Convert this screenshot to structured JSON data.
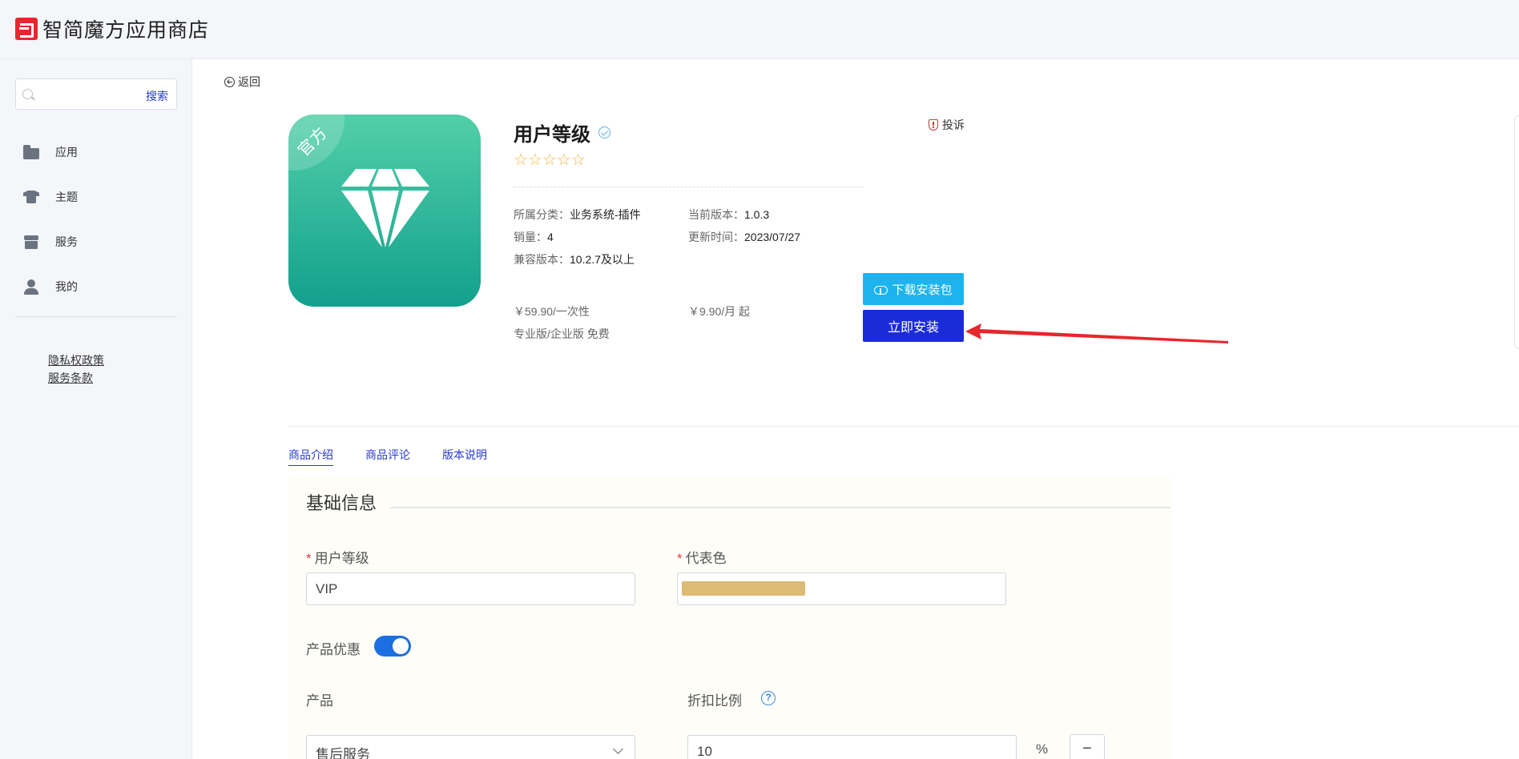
{
  "header": {
    "title": "智简魔方应用商店"
  },
  "sidebar": {
    "search": {
      "placeholder": "",
      "button": "搜索"
    },
    "items": [
      {
        "label": "应用",
        "icon": "folder-icon"
      },
      {
        "label": "主题",
        "icon": "shirt-icon"
      },
      {
        "label": "服务",
        "icon": "store-icon"
      },
      {
        "label": "我的",
        "icon": "user-icon"
      }
    ],
    "footer_links": [
      "隐私权政策",
      "服务条款"
    ]
  },
  "main": {
    "back": "返回",
    "app": {
      "badge": "官方",
      "title": "用户等级",
      "rating": 0,
      "stars": "☆☆☆☆☆",
      "category_key": "所属分类：",
      "category_value": "业务系统-插件",
      "sales_key": "销量：",
      "sales_value": "4",
      "compat_key": "兼容版本：",
      "compat_value": "10.2.7及以上",
      "version_key": "当前版本：",
      "version_value": "1.0.3",
      "updated_key": "更新时间：",
      "updated_value": "2023/07/27",
      "price_once": "￥59.90/一次性",
      "price_monthly": "￥9.90/月 起",
      "edition_note": "专业版/企业版 免费",
      "report": "投诉",
      "download_button": "下载安装包",
      "install_button": "立即安装"
    },
    "tabs": [
      {
        "label": "商品介绍",
        "active": true
      },
      {
        "label": "商品评论",
        "active": false
      },
      {
        "label": "版本说明",
        "active": false
      }
    ],
    "preview": {
      "heading": "基础信息",
      "required_mark": "*",
      "level_label": "用户等级",
      "level_value": "VIP",
      "color_label": "代表色",
      "color_value": "#ddbb74",
      "discount_label": "产品优惠",
      "discount_enabled": true,
      "product_label": "产品",
      "product_value": "售后服务",
      "ratio_label": "折扣比例",
      "ratio_value": "10",
      "percent": "%",
      "minus": "−"
    }
  },
  "colors": {
    "accent": "#2838d6",
    "install": "#1c2bd8",
    "download": "#1cb3ee",
    "app_icon_top": "#52cfa8",
    "app_icon_bottom": "#12a08d",
    "star": "#f5b63a",
    "arrow": "#e8262d"
  }
}
